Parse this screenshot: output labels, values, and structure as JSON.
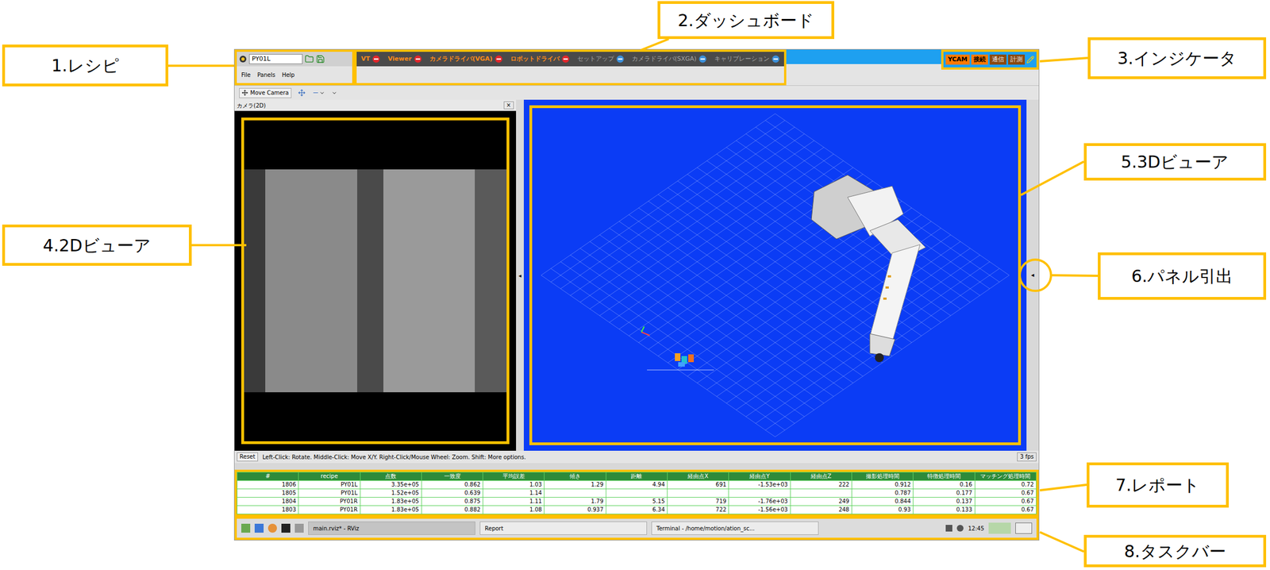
{
  "callouts": [
    {
      "label": "1.レシピ"
    },
    {
      "label": "2.ダッシュボード"
    },
    {
      "label": "3.インジケータ"
    },
    {
      "label": "4.2Dビューア"
    },
    {
      "label": "5.3Dビューア"
    },
    {
      "label": "6.パネル引出"
    },
    {
      "label": "7.レポート"
    },
    {
      "label": "8.タスクバー"
    }
  ],
  "recipe": {
    "value": "PY01L"
  },
  "menu": [
    "File",
    "Panels",
    "Help"
  ],
  "dashboard": [
    {
      "label": "VT",
      "active": true,
      "color": "#e0262b"
    },
    {
      "label": "Viewer",
      "active": true,
      "color": "#e0262b"
    },
    {
      "label": "カメラドライバ(VGA)",
      "active": true,
      "color": "#e0262b"
    },
    {
      "label": "ロボットドライバ",
      "active": true,
      "color": "#e0262b"
    },
    {
      "label": "セットアップ",
      "active": false,
      "color": "#3b8fd9"
    },
    {
      "label": "カメラドライバ(SXGA)",
      "active": false,
      "color": "#3b8fd9"
    },
    {
      "label": "キャリブレーション",
      "active": false,
      "color": "#3b8fd9"
    }
  ],
  "indicators": [
    {
      "label": "YCAM",
      "on": true
    },
    {
      "label": "接続",
      "on": true
    },
    {
      "label": "通信",
      "on": false
    },
    {
      "label": "計測",
      "on": false
    }
  ],
  "toolbar": {
    "button": "Move Camera"
  },
  "panel2d": {
    "title": "カメラ(2D)",
    "close": "×"
  },
  "splitter": "◂",
  "panel_pull": "◂",
  "status_bar": {
    "button": "Reset",
    "hint": "Left-Click: Rotate. Middle-Click: Move X/Y. Right-Click/Mouse Wheel: Zoom. Shift: More options.",
    "fps": "3 fps"
  },
  "report": {
    "columns": [
      "#",
      "recipe",
      "点数",
      "一致度",
      "平均誤差",
      "傾き",
      "距離",
      "経由点X",
      "経由点Y",
      "経由点Z",
      "撮影処理時間",
      "特徴処理時間",
      "マッチング処理時間"
    ],
    "rows": [
      [
        "1806",
        "PY01L",
        "3.35e+05",
        "0.862",
        "1.03",
        "1.29",
        "4.94",
        "691",
        "-1.53e+03",
        "222",
        "0.912",
        "0.16",
        "0.72"
      ],
      [
        "1805",
        "PY01L",
        "1.52e+05",
        "0.639",
        "1.14",
        "",
        "",
        "",
        "",
        "",
        "0.787",
        "0.177",
        "0.67"
      ],
      [
        "1804",
        "PY01R",
        "1.83e+05",
        "0.875",
        "1.11",
        "1.79",
        "5.15",
        "719",
        "-1.76e+03",
        "249",
        "0.844",
        "0.137",
        "0.67"
      ],
      [
        "1803",
        "PY01R",
        "1.83e+05",
        "0.882",
        "1.08",
        "0.937",
        "6.34",
        "722",
        "-1.56e+03",
        "248",
        "0.93",
        "0.133",
        "0.67"
      ]
    ]
  },
  "taskbar": {
    "windows": [
      {
        "label": "main.rviz* - RViz",
        "selected": true
      },
      {
        "label": "Report",
        "selected": false
      },
      {
        "label": "Terminal - /home/motion/ation_sc...",
        "selected": false
      }
    ],
    "clock": "12:45"
  }
}
